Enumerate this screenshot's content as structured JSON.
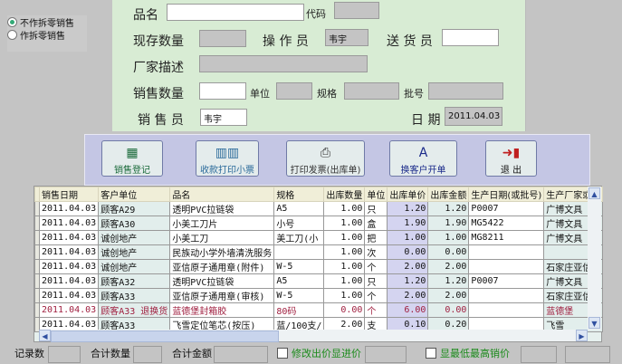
{
  "mode": {
    "options": [
      "不作拆零销售",
      "作拆零销售"
    ],
    "selected": 0
  },
  "form": {
    "product_name_label": "品名",
    "product_name_value": "",
    "code_label": "代码",
    "code_value": "",
    "stock_label": "现存数量",
    "stock_value": "",
    "operator_label": "操 作 员",
    "operator_value": "韦宇",
    "delivery_label": "送 货 员",
    "delivery_value": "",
    "maker_desc_label": "厂家描述",
    "maker_desc_value": "",
    "qty_label": "销售数量",
    "qty_value": "",
    "unit_label": "单位",
    "unit_value": "",
    "spec_label": "规格",
    "spec_value": "",
    "batch_label": "批号",
    "batch_value": "",
    "seller_label": "销 售 员",
    "seller_value": "韦宇",
    "date_label": "日 期",
    "date_value": "2011.04.03"
  },
  "buttons": [
    {
      "label": "销售登记",
      "icon": "register-icon"
    },
    {
      "label": "收款打印小票",
      "icon": "receipt-icon"
    },
    {
      "label": "打印发票(出库单)",
      "icon": "printer-icon"
    },
    {
      "label": "换客户开单",
      "icon": "document-icon"
    },
    {
      "label": "退 出",
      "icon": "exit-door-icon"
    }
  ],
  "table": {
    "headers": [
      "销售日期",
      "客户单位",
      "品名",
      "规格",
      "出库数量",
      "单位",
      "出库单价",
      "出库金额",
      "生产日期(或批号)",
      "生产厂家或描"
    ],
    "rows": [
      [
        "2011.04.03",
        "顾客A29",
        "透明PVC拉链袋",
        "A5",
        "1.00",
        "只",
        "1.20",
        "1.20",
        "P0007",
        "广博文具"
      ],
      [
        "2011.04.03",
        "顾客A30",
        "小美工刀片",
        "小号",
        "1.00",
        "盒",
        "1.90",
        "1.90",
        "MG5422",
        "广博文具"
      ],
      [
        "2011.04.03",
        "诚创地产",
        "小美工刀",
        "美工刀(小",
        "1.00",
        "把",
        "1.00",
        "1.00",
        "MG8211",
        "广博文具"
      ],
      [
        "2011.04.03",
        "诚创地产",
        "民族动小学外墙清洗服务",
        "",
        "1.00",
        "次",
        "0.00",
        "0.00",
        "",
        ""
      ],
      [
        "2011.04.03",
        "诚创地产",
        "亚信原子通用章(附件)",
        " W-5",
        "1.00",
        "个",
        "2.00",
        "2.00",
        "",
        "石家庄亚信文"
      ],
      [
        "2011.04.03",
        "顾客A32",
        "透明PVC拉链袋",
        "A5",
        "1.00",
        "只",
        "1.20",
        "1.20",
        "P0007",
        "广博文具"
      ],
      [
        "2011.04.03",
        "顾客A33",
        "亚信原子通用章(审核)",
        "W-5",
        "1.00",
        "个",
        "2.00",
        "2.00",
        "",
        "石家庄亚信文"
      ],
      [
        "2011.04.03",
        "顾客A33 退换货",
        "蓝德堡封箱胶",
        "80码",
        "0.00",
        "个",
        "6.00",
        "0.00",
        "",
        "蓝德堡"
      ],
      [
        "2011.04.03",
        "顾客A33",
        "飞雪定位笔芯(按压)",
        "蓝/100支/",
        "2.00",
        "支",
        "0.10",
        "0.20",
        "",
        "飞雪"
      ]
    ],
    "highlight_row": 7
  },
  "footer": {
    "record_count_label": "记录数",
    "record_count": "",
    "total_qty_label": "合计数量",
    "total_qty": "",
    "total_amount_label": "合计金额",
    "total_amount": "",
    "show_cost_label": "修改出价显进价",
    "show_cost_checked": false,
    "show_cost_value": "",
    "show_minmax_label": "显最低最高销价",
    "show_minmax_checked": false,
    "show_minmax_value": ""
  }
}
